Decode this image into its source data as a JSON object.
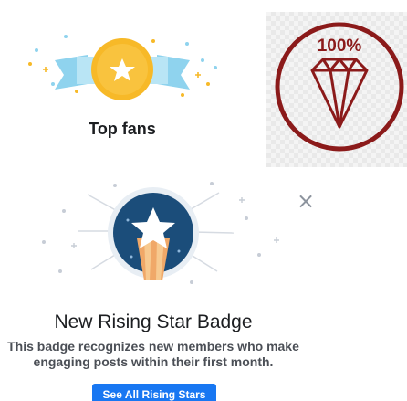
{
  "top_fans": {
    "label": "Top fans",
    "badge_icon": "star-icon",
    "colors": {
      "medal": "#f7b928",
      "ribbon": "#8fd3ee",
      "star": "#ffffff"
    }
  },
  "diamond": {
    "percent_label": "100%",
    "icon": "diamond-icon",
    "colors": {
      "ring": "#8b1a1a"
    }
  },
  "rising_star": {
    "title": "New Rising Star Badge",
    "description_line1": "This badge recognizes new members who make",
    "description_line2": "engaging posts within their first month.",
    "button_label": "See All Rising Stars",
    "close_glyph": "×",
    "icon": "rising-star-icon",
    "colors": {
      "circle": "#1b4d7a",
      "accent": "#f0a868",
      "button": "#1877f2"
    }
  }
}
